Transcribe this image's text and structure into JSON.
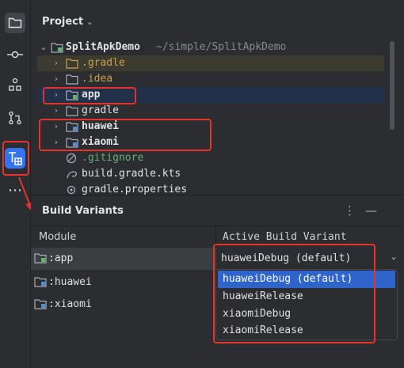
{
  "project": {
    "header": "Project",
    "root": {
      "name": "SplitApkDemo",
      "path": "~/simple/SplitApkDemo"
    },
    "items": [
      {
        "label": ".gradle"
      },
      {
        "label": ".idea"
      },
      {
        "label": "app"
      },
      {
        "label": "gradle"
      },
      {
        "label": "huawei"
      },
      {
        "label": "xiaomi"
      },
      {
        "label": ".gitignore"
      },
      {
        "label": "build.gradle.kts"
      },
      {
        "label": "gradle.properties"
      }
    ]
  },
  "build_variants": {
    "title": "Build Variants",
    "columns": [
      "Module",
      "Active Build Variant"
    ],
    "rows": [
      {
        "module": ":app",
        "variant": "huaweiDebug (default)"
      },
      {
        "module": ":huawei",
        "variant": ""
      },
      {
        "module": ":xiaomi",
        "variant": ""
      }
    ],
    "dropdown": {
      "options": [
        "huaweiDebug (default)",
        "huaweiRelease",
        "xiaomiDebug",
        "xiaomiRelease"
      ],
      "selected": "huaweiDebug (default)"
    }
  },
  "colors": {
    "accent": "#3574f0",
    "highlight": "#e5322d",
    "excluded_text": "#c9a24a",
    "vcs_text": "#6aab73"
  }
}
